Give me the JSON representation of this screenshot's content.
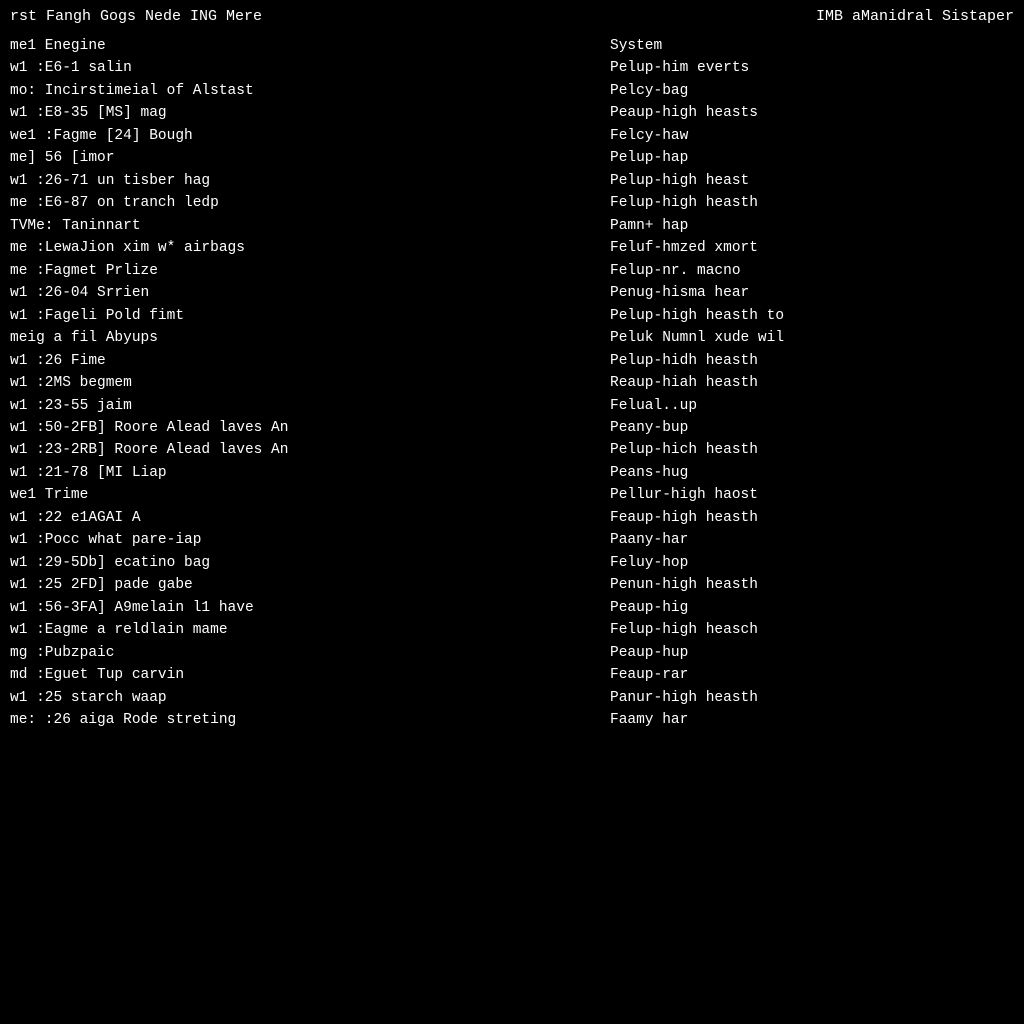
{
  "header": {
    "left": "rst Fangh Gogs Nede ING Mere",
    "right": "IMB aManidral Sistaper"
  },
  "rows": [
    {
      "left": "me1 Enegine",
      "right": "System"
    },
    {
      "left": "w1 :E6-1 salin",
      "right": "Pelup-him everts"
    },
    {
      "left": "mo: Incirstimeial of Alstast",
      "right": "Pelcy-bag"
    },
    {
      "left": "w1 :E8-35 [MS] mag",
      "right": "Peaup-high heasts"
    },
    {
      "left": "we1 :Fagme [24] Bough",
      "right": "Felcy-haw"
    },
    {
      "left": "me] 56 [imor",
      "right": "Pelup-hap"
    },
    {
      "left": "w1 :26-71 un tisber hag",
      "right": "Pelup-high heast"
    },
    {
      "left": "me :E6-87 on tranch ledp",
      "right": "Felup-high heasth"
    },
    {
      "left": "TVMe: Taninnart",
      "right": "Pamn+ hap"
    },
    {
      "left": "me :LewaJion xim w* airbags",
      "right": "Feluf-hmzed xmort"
    },
    {
      "left": "me :Fagmet Prlize",
      "right": "Felup-nr. macno"
    },
    {
      "left": "w1 :26-04 Srrien",
      "right": "Penug-hisma hear"
    },
    {
      "left": "w1 :Fageli Pold fimt",
      "right": "Pelup-high heasth to"
    },
    {
      "left": "meig a fil Abyups",
      "right": "Peluk Numnl xude wil"
    },
    {
      "left": "w1 :26 Fime",
      "right": "Pelup-hidh heasth"
    },
    {
      "left": "w1 :2MS begmem",
      "right": "Reaup-hiah heasth"
    },
    {
      "left": "w1 :23-55 jaim",
      "right": "Felual..up"
    },
    {
      "left": "w1 :50-2FB] Roore Alead laves An",
      "right": "Peany-bup"
    },
    {
      "left": "w1 :23-2RB] Roore Alead laves An",
      "right": "Pelup-hich heasth"
    },
    {
      "left": "w1 :21-78 [MI Liap",
      "right": "Peans-hug"
    },
    {
      "left": "we1 Trime",
      "right": "Pellur-high haost"
    },
    {
      "left": "w1 :22 e1AGAI A",
      "right": "Feaup-high heasth"
    },
    {
      "left": "w1 :Pocc what pare-iap",
      "right": "Paany-har"
    },
    {
      "left": "w1 :29-5Db] ecatino bag",
      "right": "Feluy-hop"
    },
    {
      "left": "w1 :25 2FD] pade gabe",
      "right": "Penun-high heasth"
    },
    {
      "left": "w1 :56-3FA] A9melain l1 have",
      "right": "Peaup-hig"
    },
    {
      "left": "w1 :Eagme a reldlain mame",
      "right": "Felup-high heasch"
    },
    {
      "left": "mg :Pubzpaic",
      "right": "Peaup-hup"
    },
    {
      "left": "md :Eguet Tup carvin",
      "right": "Feaup-rar"
    },
    {
      "left": "w1 :25 starch waap",
      "right": "Panur-high heasth"
    },
    {
      "left": "me: :26 aiga Rode streting",
      "right": "Faamy har"
    }
  ]
}
